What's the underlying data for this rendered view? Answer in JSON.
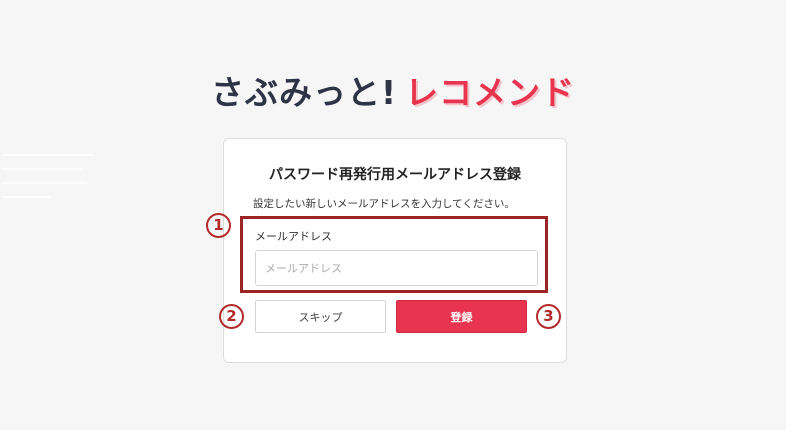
{
  "logo": {
    "main_text": "さぶみっと!",
    "accent_text": "レコメンド"
  },
  "card": {
    "title": "パスワード再発行用メールアドレス登録",
    "description": "設定したい新しいメールアドレスを入力してください。",
    "email_label": "メールアドレス",
    "email_placeholder": "メールアドレス",
    "email_value": "",
    "skip_label": "スキップ",
    "register_label": "登録"
  },
  "markers": {
    "one": "1",
    "two": "2",
    "three": "3"
  },
  "colors": {
    "accent": "#e8344e",
    "logo_dark": "#2e3346",
    "annotation": "#b22a2a",
    "background": "#f6f6f6"
  }
}
